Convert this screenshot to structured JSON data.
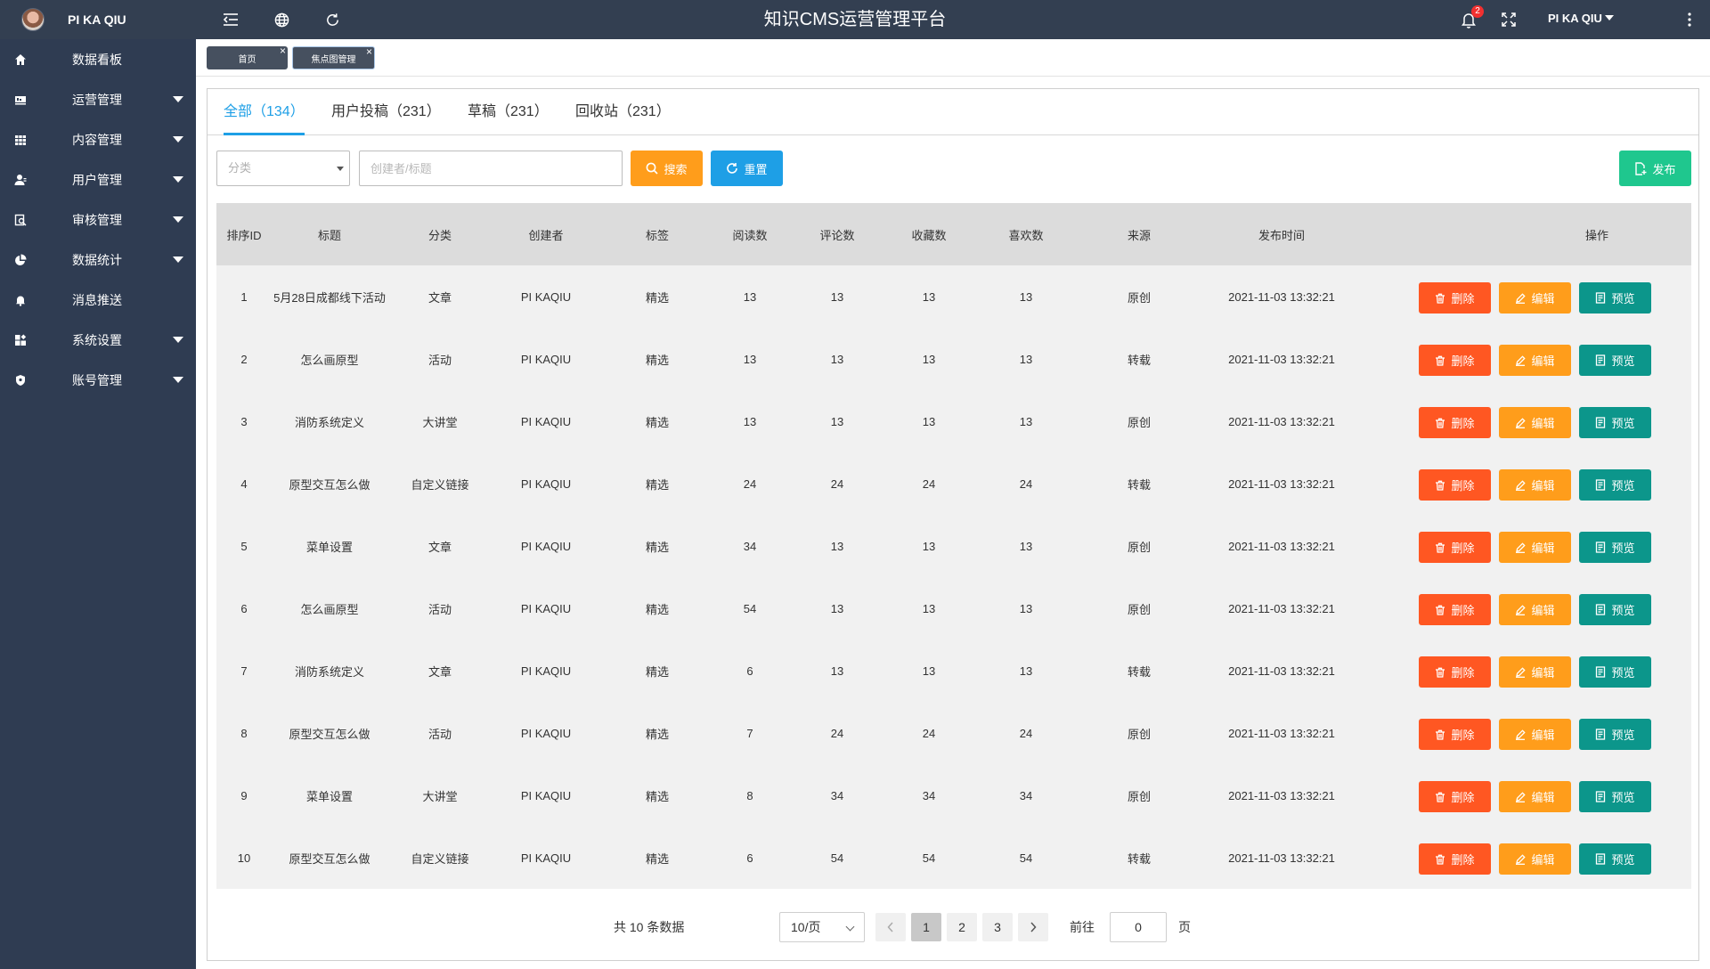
{
  "app": {
    "title": "知识CMS运营管理平台",
    "user_name": "PI KA QIU",
    "notification_count": "2",
    "user_menu_label": "PI KA QIU"
  },
  "sidebar": {
    "items": [
      {
        "label": "数据看板",
        "icon": "home-icon",
        "has_submenu": false
      },
      {
        "label": "运营管理",
        "icon": "monitor-icon",
        "has_submenu": true
      },
      {
        "label": "内容管理",
        "icon": "grid-icon",
        "has_submenu": true
      },
      {
        "label": "用户管理",
        "icon": "user-icon",
        "has_submenu": true
      },
      {
        "label": "审核管理",
        "icon": "review-icon",
        "has_submenu": true
      },
      {
        "label": "数据统计",
        "icon": "pie-chart-icon",
        "has_submenu": true
      },
      {
        "label": "消息推送",
        "icon": "bell-icon",
        "has_submenu": false
      },
      {
        "label": "系统设置",
        "icon": "settings-icon",
        "has_submenu": true
      },
      {
        "label": "账号管理",
        "icon": "shield-icon",
        "has_submenu": true
      }
    ]
  },
  "page_tabs": [
    {
      "label": "首页",
      "active": false
    },
    {
      "label": "焦点图管理",
      "active": true
    }
  ],
  "filter_tabs": [
    {
      "label": "全部（134）",
      "active": true
    },
    {
      "label": "用户投稿（231）",
      "active": false
    },
    {
      "label": "草稿（231）",
      "active": false
    },
    {
      "label": "回收站（231）",
      "active": false
    }
  ],
  "toolbar": {
    "category_placeholder": "分类",
    "search_placeholder": "创建者/标题",
    "search_label": "搜索",
    "reset_label": "重置",
    "publish_label": "发布"
  },
  "table": {
    "headers": [
      "排序ID",
      "标题",
      "分类",
      "创建者",
      "标签",
      "阅读数",
      "评论数",
      "收藏数",
      "喜欢数",
      "来源",
      "发布时间",
      "操作"
    ],
    "actions": {
      "delete": "删除",
      "edit": "编辑",
      "preview": "预览"
    },
    "rows": [
      [
        "1",
        "5月28日成都线下活动",
        "文章",
        "PI KAQIU",
        "精选",
        "13",
        "13",
        "13",
        "13",
        "原创",
        "2021-11-03  13:32:21"
      ],
      [
        "2",
        "怎么画原型",
        "活动",
        "PI KAQIU",
        "精选",
        "13",
        "13",
        "13",
        "13",
        "转载",
        "2021-11-03  13:32:21"
      ],
      [
        "3",
        "消防系统定义",
        "大讲堂",
        "PI KAQIU",
        "精选",
        "13",
        "13",
        "13",
        "13",
        "原创",
        "2021-11-03  13:32:21"
      ],
      [
        "4",
        "原型交互怎么做",
        "自定义链接",
        "PI KAQIU",
        "精选",
        "24",
        "24",
        "24",
        "24",
        "转载",
        "2021-11-03  13:32:21"
      ],
      [
        "5",
        "菜单设置",
        "文章",
        "PI KAQIU",
        "精选",
        "34",
        "13",
        "13",
        "13",
        "原创",
        "2021-11-03  13:32:21"
      ],
      [
        "6",
        "怎么画原型",
        "活动",
        "PI KAQIU",
        "精选",
        "54",
        "13",
        "13",
        "13",
        "原创",
        "2021-11-03  13:32:21"
      ],
      [
        "7",
        "消防系统定义",
        "文章",
        "PI KAQIU",
        "精选",
        "6",
        "13",
        "13",
        "13",
        "转载",
        "2021-11-03  13:32:21"
      ],
      [
        "8",
        "原型交互怎么做",
        "活动",
        "PI KAQIU",
        "精选",
        "7",
        "24",
        "24",
        "24",
        "原创",
        "2021-11-03  13:32:21"
      ],
      [
        "9",
        "菜单设置",
        "大讲堂",
        "PI KAQIU",
        "精选",
        "8",
        "34",
        "34",
        "34",
        "原创",
        "2021-11-03  13:32:21"
      ],
      [
        "10",
        "原型交互怎么做",
        "自定义链接",
        "PI KAQIU",
        "精选",
        "6",
        "54",
        "54",
        "54",
        "转载",
        "2021-11-03  13:32:21"
      ]
    ]
  },
  "pagination": {
    "total_text": "共 10 条数据",
    "page_size": "10/页",
    "pages": [
      "1",
      "2",
      "3"
    ],
    "current_page": "1",
    "goto_label": "前往",
    "goto_value": "0",
    "page_suffix": "页"
  },
  "colors": {
    "topbar": "#333f51",
    "sidebar": "#2f3c52",
    "accent_blue": "#1e9fe6",
    "search_orange": "#ff9d1b",
    "delete_red": "#ff5722",
    "preview_teal": "#0c968b",
    "publish_green": "#1fc78e"
  }
}
